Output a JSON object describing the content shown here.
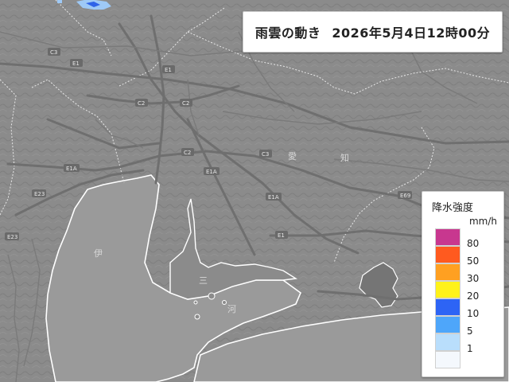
{
  "header": {
    "title": "雨雲の動き",
    "datetime": "2026年5月4日12時00分"
  },
  "legend": {
    "title": "降水強度",
    "unit": "mm/h",
    "levels": [
      {
        "label": "80",
        "color": "#c8378f"
      },
      {
        "label": "50",
        "color": "#ff5a1f"
      },
      {
        "label": "30",
        "color": "#ffa021"
      },
      {
        "label": "20",
        "color": "#fff21a"
      },
      {
        "label": "10",
        "color": "#2d64f5"
      },
      {
        "label": "5",
        "color": "#4ea6fa"
      },
      {
        "label": "1",
        "color": "#b9defc"
      },
      {
        "label": "",
        "color": "#f4f8fd"
      }
    ]
  },
  "map_labels": {
    "aichi_1": "愛",
    "aichi_2": "知",
    "ise": "伊",
    "chita_1": "三",
    "chita_2": "河"
  },
  "road_labels": [
    "C3",
    "E1",
    "E1",
    "C2",
    "C2",
    "E1A",
    "C3",
    "E1A",
    "E23",
    "E1",
    "E1A",
    "E23",
    "E69",
    "C2"
  ],
  "colors": {
    "land": "#8e8e8e",
    "sea": "#9c9c9c",
    "roads": "#6e6e6e",
    "coast": "#ffffff",
    "rain_light": "#9ec9f6",
    "rain_mid": "#2f63e8"
  }
}
